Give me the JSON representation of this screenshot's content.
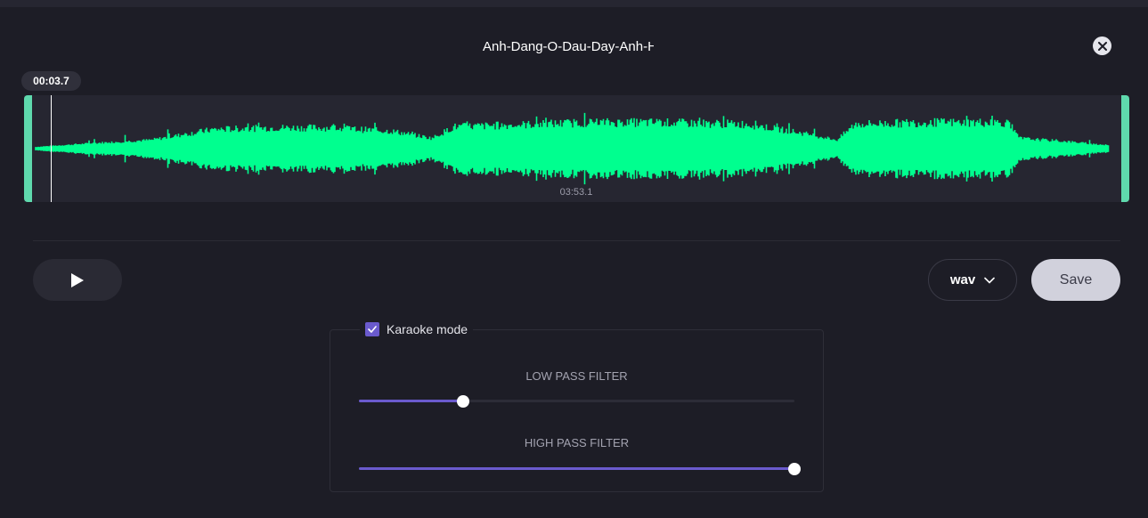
{
  "title": "Anh-Dang-O-Dau-Day-Anh-H",
  "current_time": "00:03.7",
  "duration": "03:53.1",
  "format": {
    "selected": "wav"
  },
  "buttons": {
    "save": "Save"
  },
  "karaoke": {
    "label": "Karaoke mode",
    "checked": true
  },
  "filters": {
    "low_pass": {
      "label": "LOW PASS FILTER",
      "level": 0.24
    },
    "high_pass": {
      "label": "HIGH PASS FILTER",
      "level": 1.0
    }
  },
  "icons": {
    "close": "close-icon",
    "play": "play-icon",
    "dropdown": "chevron-down-icon",
    "check": "check-icon"
  },
  "colors": {
    "background": "#1d1d26",
    "waveform": "#00ff8f",
    "trim_handle": "#5fd9ad",
    "accent": "#6a5acd",
    "save_button": "#d1d1dc"
  }
}
